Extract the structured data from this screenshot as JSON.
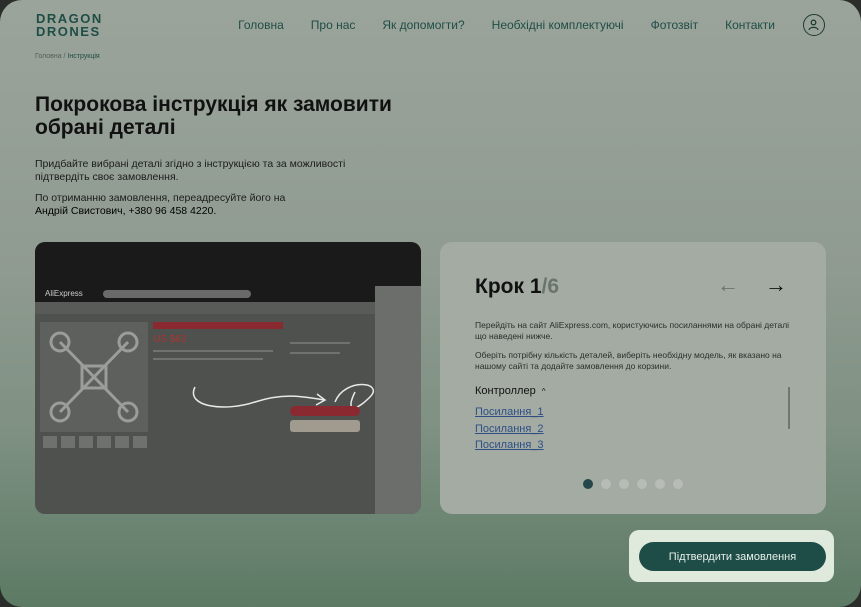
{
  "brand": {
    "line1": "DRAGON",
    "line2": "DRONES"
  },
  "nav": [
    "Головна",
    "Про нас",
    "Як допомогти?",
    "Необхідні комплектуючі",
    "Фотозвіт",
    "Контакти"
  ],
  "user_icon": "user-icon",
  "breadcrumb": {
    "home": "Головна /",
    "current": "Інструкція"
  },
  "title": "Покрокова інструкція як замовити обрані деталі",
  "intro": "Придбайте вибрані деталі згідно з інструкцією та за можливості підтвердіть своє замовлення.",
  "forward": "По отриманню замовлення, переадресуйте його на",
  "contact": "Андрій Свистович, +380 96 458 4220.",
  "screenshot": {
    "brand": "AliExpress",
    "price": "US $63"
  },
  "step": {
    "current": "Крок 1",
    "total": "/6"
  },
  "arrows": {
    "prev": "←",
    "next": "→"
  },
  "step_text_1": "Перейдіть на сайт AliExpress.com, користуючись посиланнями на обрані деталі що наведені нижче.",
  "step_text_2": "Оберіть потрібну кількість деталей, виберіть необхідну модель, як вказано на нашому сайті та додайте замовлення до корзини.",
  "section": "Контроллер",
  "links": [
    "Посилання_1",
    "Посилання_2",
    "Посилання_3"
  ],
  "pager": {
    "count": 6,
    "active": 1
  },
  "confirm_label": "Підтвердити замовлення",
  "colors": {
    "accent": "#1e4d48",
    "active_dot": "#24474a"
  }
}
